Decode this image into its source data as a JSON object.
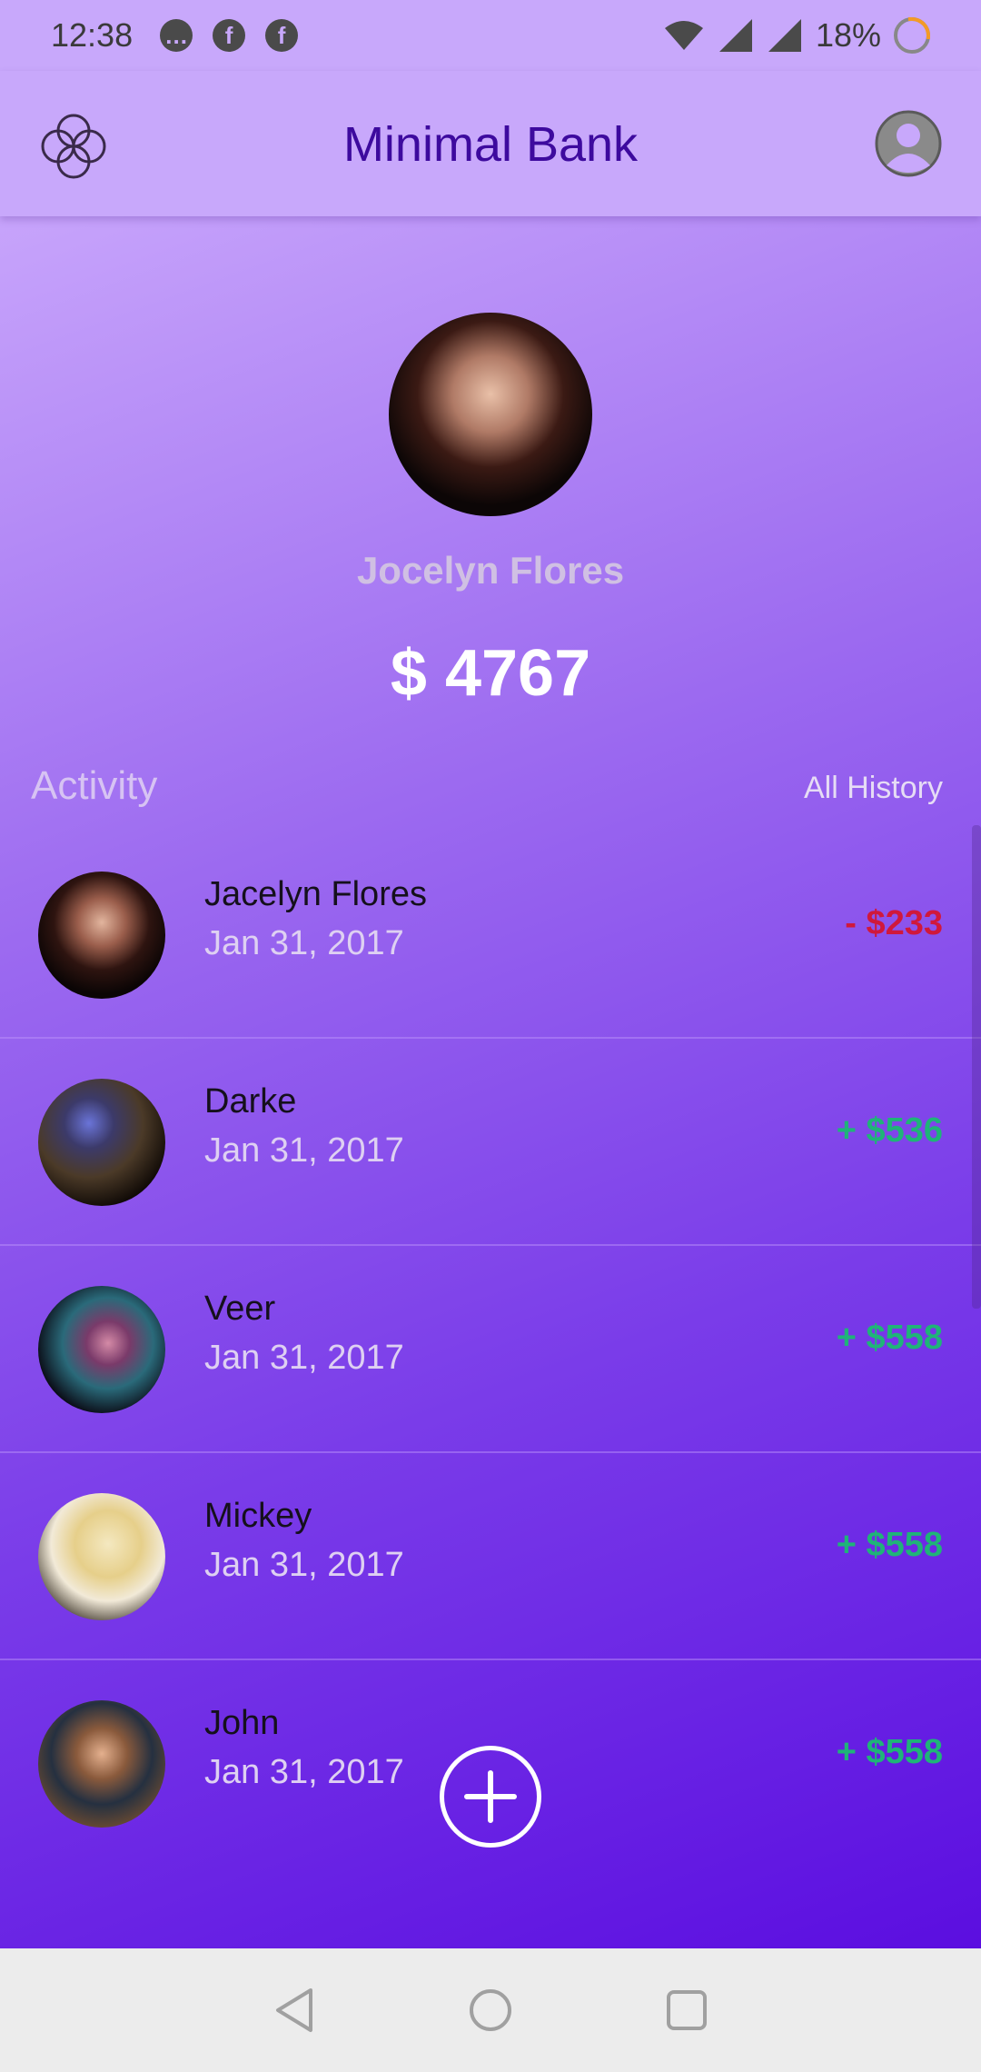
{
  "status_bar": {
    "time": "12:38",
    "notification_icons": [
      "message-icon",
      "facebook-icon",
      "facebook-icon"
    ],
    "wifi_icon": "wifi-icon",
    "signal_icon": "cell-signal-icon",
    "battery": "18%"
  },
  "app_bar": {
    "title": "Minimal Bank",
    "logo_icon": "flower-logo-icon",
    "profile_icon": "account-circle-icon"
  },
  "profile": {
    "name": "Jocelyn Flores",
    "balance": "$ 4767"
  },
  "activity": {
    "title": "Activity",
    "all_history_label": "All History",
    "items": [
      {
        "name": "Jacelyn Flores",
        "date": "Jan 31, 2017",
        "amount": "- $233",
        "type": "debit"
      },
      {
        "name": "Darke",
        "date": "Jan 31, 2017",
        "amount": "+ $536",
        "type": "credit"
      },
      {
        "name": "Veer",
        "date": "Jan 31, 2017",
        "amount": "+ $558",
        "type": "credit"
      },
      {
        "name": "Mickey",
        "date": "Jan 31, 2017",
        "amount": "+ $558",
        "type": "credit"
      },
      {
        "name": "John",
        "date": "Jan 31, 2017",
        "amount": "+ $558",
        "type": "credit"
      }
    ]
  },
  "colors": {
    "title": "#3d0a9e",
    "debit": "#d0183c",
    "credit": "#1fb478"
  },
  "nav_bar": [
    "back-icon",
    "home-icon",
    "recents-icon"
  ]
}
